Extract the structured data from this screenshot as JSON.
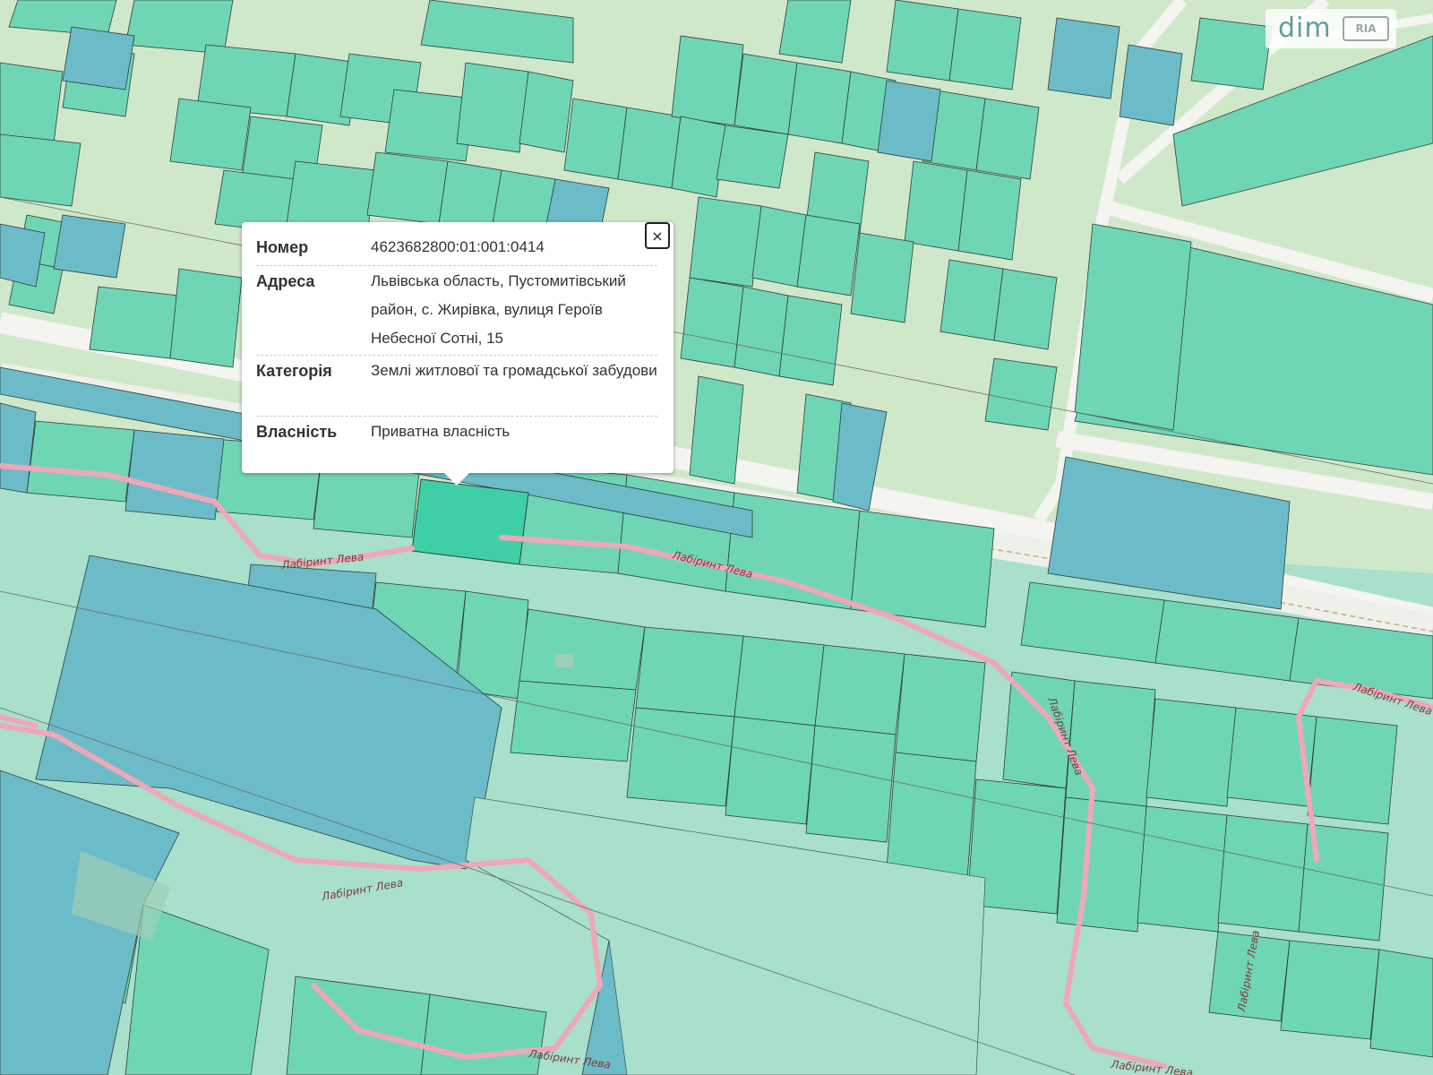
{
  "map": {
    "colors": {
      "background": "#cfe8c9",
      "parcel_green": "#6fd6b5",
      "parcel_light": "#a8e0cb",
      "parcel_blue": "#6bbcc8",
      "parcel_selected": "#3fcfa6",
      "path_pink": "#f0a7b8",
      "road": "#f2f2ee"
    },
    "path_label": "Лабіринт Лева"
  },
  "popup": {
    "close_label": "×",
    "rows": [
      {
        "label": "Номер",
        "value": "4623682800:01:001:0414"
      },
      {
        "label": "Адреса",
        "value": "Львівська область, Пустомитівський район, с. Жирівка, вулиця Героїв Небесної Сотні, 15"
      },
      {
        "label": "Категорія",
        "value": "Землі житлової та громадської забудови"
      },
      {
        "label": "Власність",
        "value": "Приватна власність"
      }
    ]
  },
  "watermark": {
    "text": "dim",
    "badge": "RIA"
  }
}
